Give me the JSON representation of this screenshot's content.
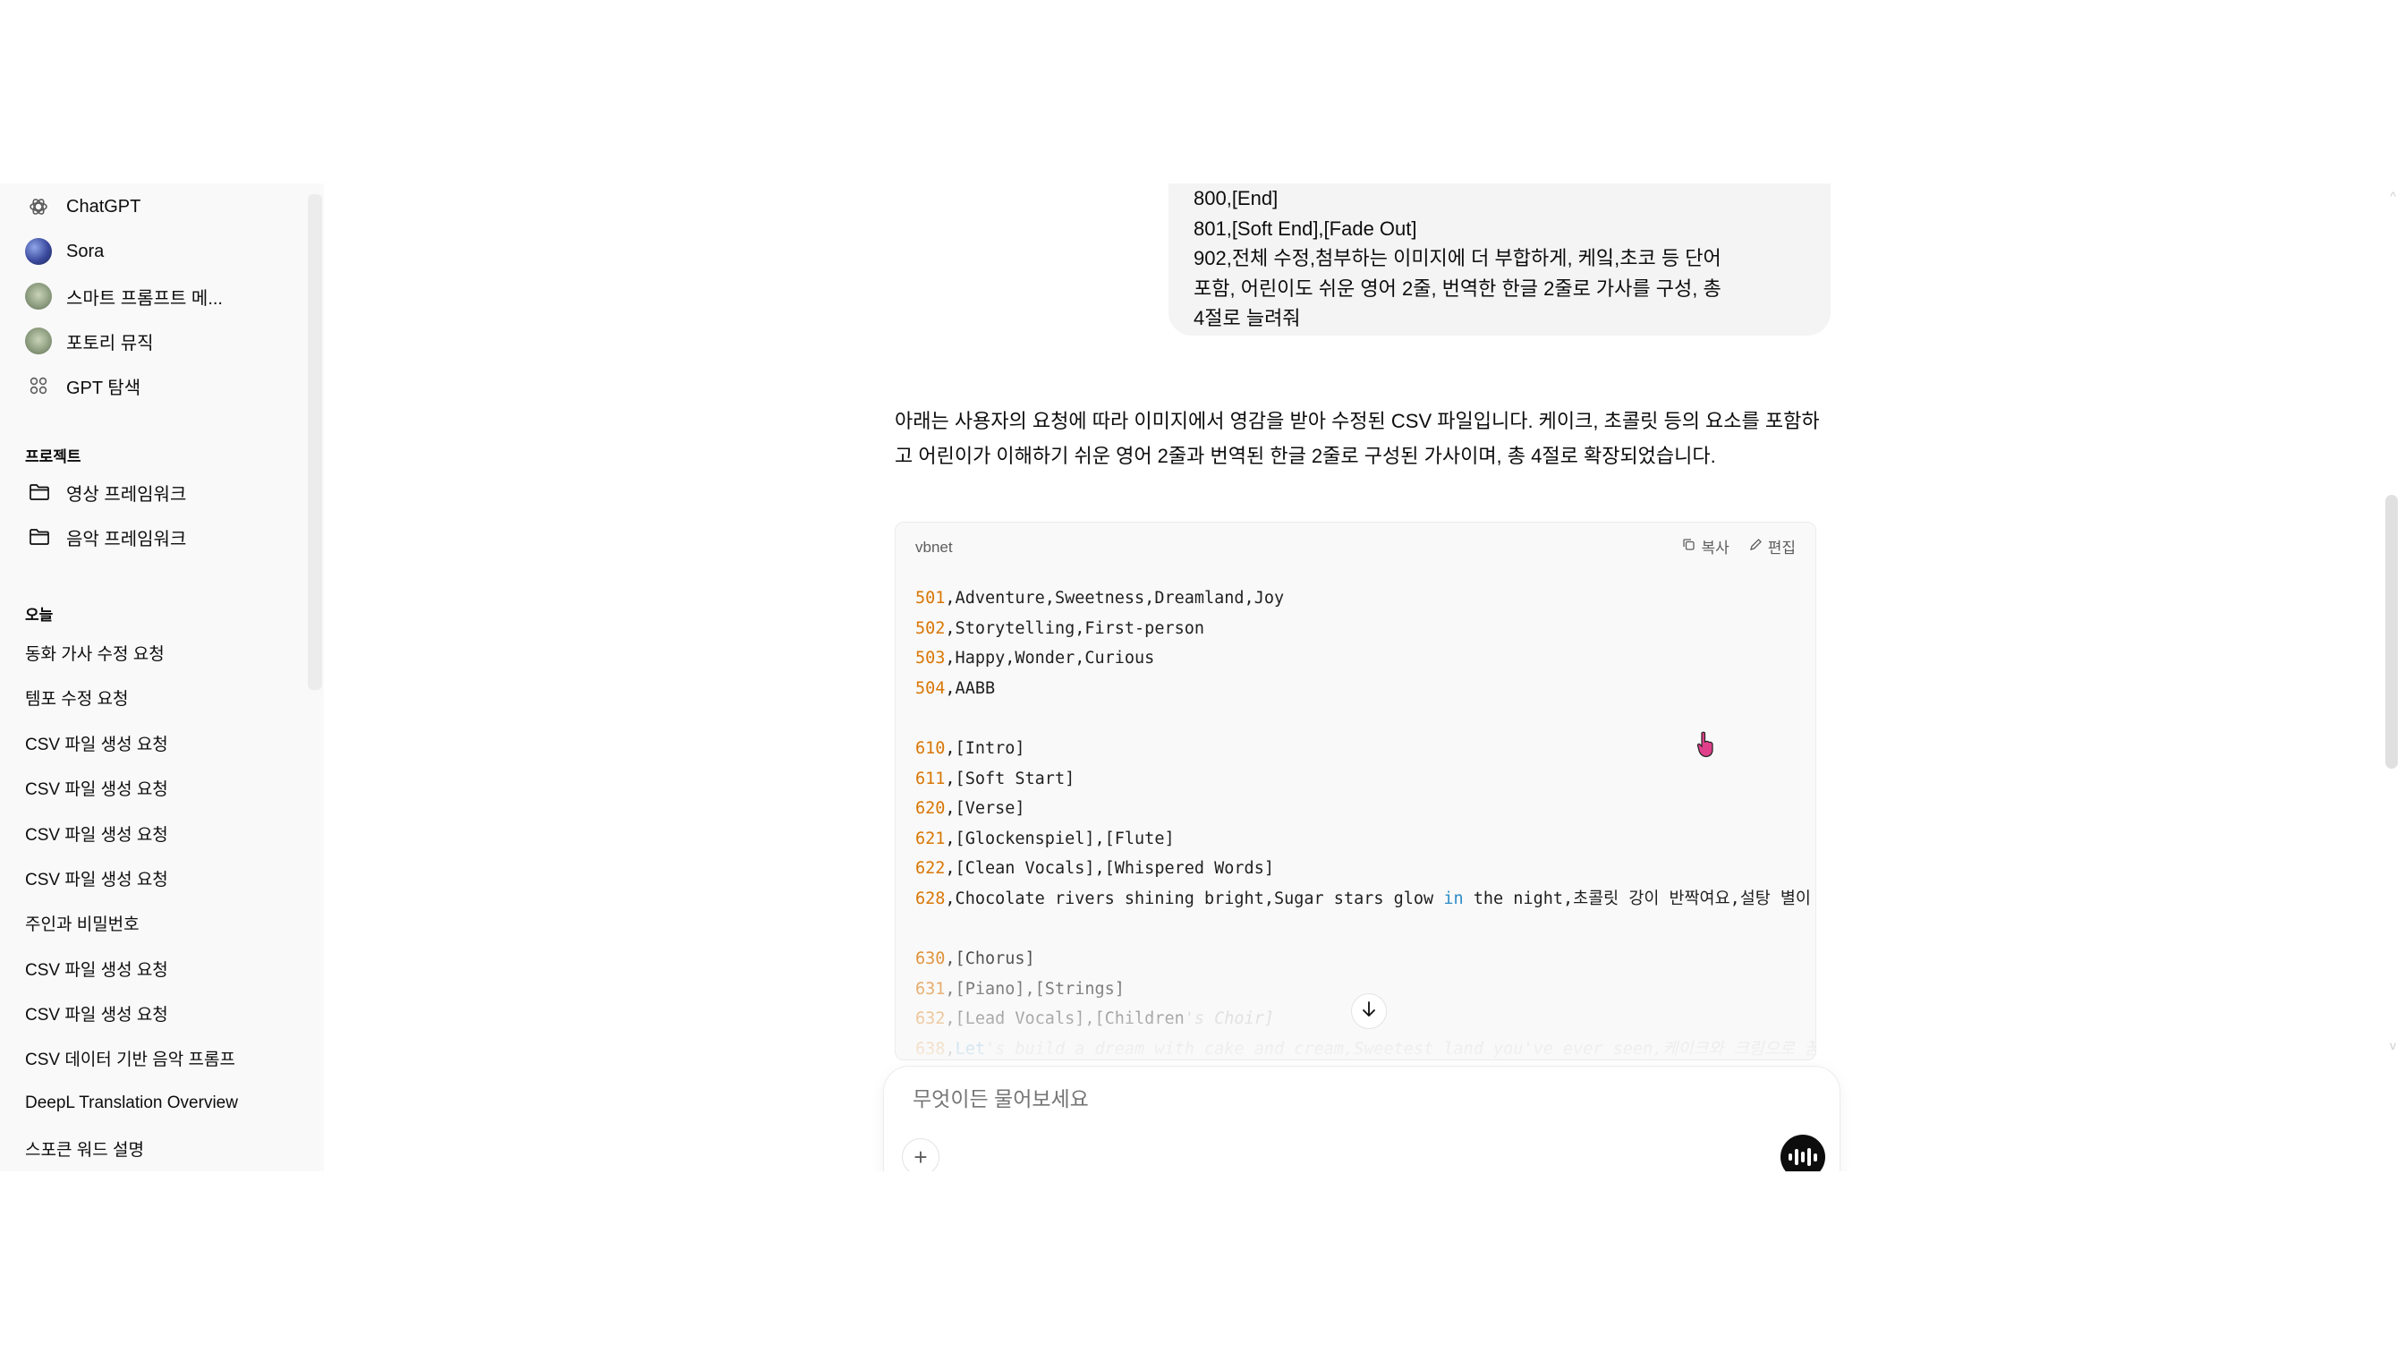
{
  "sidebar": {
    "gpts": [
      {
        "label": "ChatGPT",
        "icon": "openai-logo-icon"
      },
      {
        "label": "Sora",
        "icon": "sora-avatar"
      },
      {
        "label": "스마트 프롬프트 메...",
        "icon": "gpt-avatar"
      },
      {
        "label": "포토리 뮤직",
        "icon": "gpt-avatar"
      },
      {
        "label": "GPT 탐색",
        "icon": "grid-icon"
      }
    ],
    "projects_heading": "프로젝트",
    "projects": [
      {
        "label": "영상 프레임워크"
      },
      {
        "label": "음악 프레임워크"
      }
    ],
    "today_heading": "오늘",
    "history": [
      "동화 가사 수정 요청",
      "템포 수정 요청",
      "CSV 파일 생성 요청",
      "CSV 파일 생성 요청",
      "CSV 파일 생성 요청",
      "CSV 파일 생성 요청",
      "주인과 비밀번호",
      "CSV 파일 생성 요청",
      "CSV 파일 생성 요청",
      "CSV 데이터 기반 음악 프롬프",
      "DeepL Translation Overview",
      "스포큰 워드 설명"
    ]
  },
  "user_message": {
    "lines": [
      "800,[End]",
      "801,[Soft End],[Fade Out]",
      "902,전체 수정,첨부하는 이미지에 더 부합하게, 케잌,초코 등 단어",
      "포함, 어린이도 쉬운 영어 2줄, 번역한 한글 2줄로 가사를 구성, 총",
      "4절로 늘려줘"
    ]
  },
  "assistant": {
    "intro": "아래는 사용자의 요청에 따라 이미지에서 영감을 받아 수정된 CSV 파일입니다. 케이크, 초콜릿 등의 요소를 포함하고 어린이가 이해하기 쉬운 영어 2줄과 번역된 한글 2줄로 구성된 가사이며, 총 4절로 확장되었습니다.",
    "code": {
      "language": "vbnet",
      "copy_label": "복사",
      "edit_label": "편집",
      "lines": [
        {
          "num": "501",
          "rest": ",Adventure,Sweetness,Dreamland,Joy"
        },
        {
          "num": "502",
          "rest": ",Storytelling,First-person"
        },
        {
          "num": "503",
          "rest": ",Happy,Wonder,Curious"
        },
        {
          "num": "504",
          "rest": ",AABB"
        },
        {
          "num": "",
          "rest": ""
        },
        {
          "num": "610",
          "rest": ",[Intro]"
        },
        {
          "num": "611",
          "rest": ",[Soft Start]"
        },
        {
          "num": "620",
          "rest": ",[Verse]"
        },
        {
          "num": "621",
          "rest": ",[Glockenspiel],[Flute]"
        },
        {
          "num": "622",
          "rest": ",[Clean Vocals],[Whispered Words]"
        },
        {
          "num": "628",
          "rest": ",Chocolate rivers shining bright,Sugar stars glow ",
          "kw": "in",
          "tail": " the night,초콜릿 강이 반짝여요,설탕 별이"
        },
        {
          "num": "",
          "rest": ""
        },
        {
          "num": "630",
          "rest": ",[Chorus]"
        },
        {
          "num": "631",
          "rest": ",[Piano],[Strings]"
        },
        {
          "num": "632",
          "rest": ",[Lead Vocals],[Children",
          "fade": "'s Choir]"
        },
        {
          "num": "638",
          "rest": ",",
          "kw": "Let",
          "fade": "'s build a dream with cake and cream,Sweetest land you've ever seen,케이크와 크림으로 꿈"
        }
      ]
    }
  },
  "composer": {
    "placeholder": "무엇이든 물어보세요"
  }
}
